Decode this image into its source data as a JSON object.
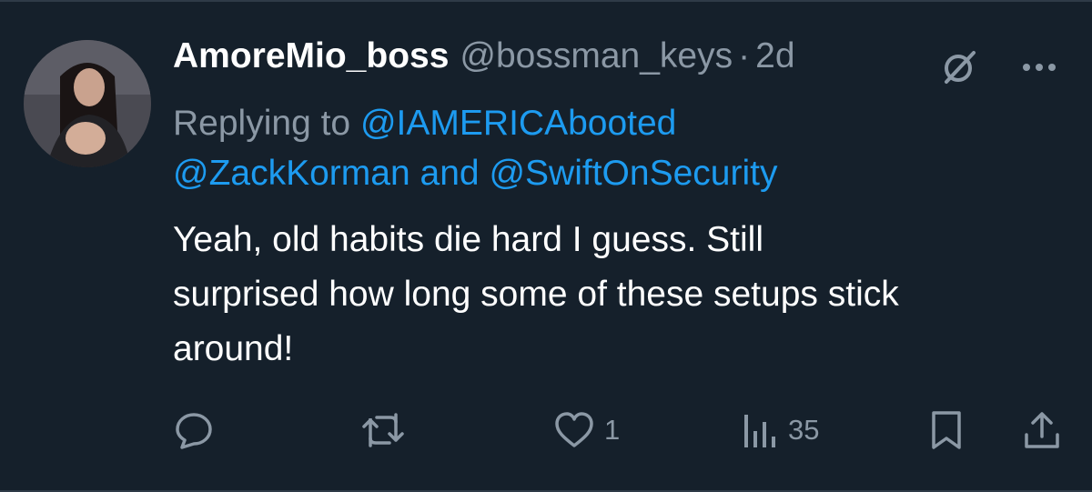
{
  "tweet": {
    "display_name": "AmoreMio_boss",
    "handle": "@bossman_keys",
    "separator": "·",
    "time": "2d",
    "replying_prefix": "Replying to",
    "replying_to": [
      "@IAMERICAbooted",
      "@ZackKorman"
    ],
    "replying_and": "and",
    "replying_last": "@SwiftOnSecurity",
    "text_line1": "Yeah, old habits die hard I guess. Still",
    "text_line2": "surprised how long some of these setups stick",
    "text_line3": "around!"
  },
  "actions": {
    "reply_icon": "speech-bubble-icon",
    "retweet_icon": "retweet-icon",
    "like_icon": "heart-icon",
    "like_count": "1",
    "views_icon": "bar-chart-icon",
    "views_count": "35",
    "bookmark_icon": "bookmark-icon",
    "share_icon": "share-icon"
  },
  "header_icons": {
    "grok_icon": "grok-slash-circle-icon",
    "more_icon": "more-dots-icon"
  },
  "colors": {
    "background": "#15202b",
    "accent": "#1d9bf0",
    "secondary_text": "#8b98a5",
    "primary_text": "#ffffff"
  }
}
